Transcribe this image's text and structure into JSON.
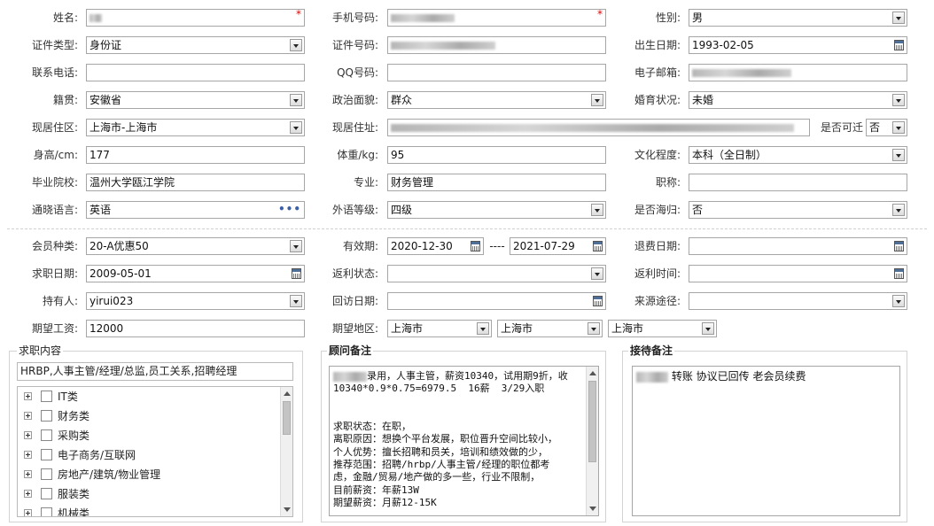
{
  "personal": {
    "name": {
      "label": "姓名:",
      "value_masked": true,
      "required_mark": "*"
    },
    "mobile": {
      "label": "手机号码:",
      "value_masked": true,
      "required_mark": "*"
    },
    "gender": {
      "label": "性别:",
      "value": "男"
    },
    "id_type": {
      "label": "证件类型:",
      "value": "身份证"
    },
    "id_number": {
      "label": "证件号码:",
      "value_masked": true
    },
    "birth_date": {
      "label": "出生日期:",
      "value": "1993-02-05"
    },
    "phone": {
      "label": "联系电话:",
      "value": ""
    },
    "qq": {
      "label": "QQ号码:",
      "value": ""
    },
    "email": {
      "label": "电子邮箱:",
      "value_masked": true
    },
    "native_place": {
      "label": "籍贯:",
      "value": "安徽省"
    },
    "political_status": {
      "label": "政治面貌:",
      "value": "群众"
    },
    "marital_status": {
      "label": "婚育状况:",
      "value": "未婚"
    },
    "residence_area": {
      "label": "现居住区:",
      "value": "上海市-上海市"
    },
    "residence_address": {
      "label": "现居住址:",
      "value_masked": true
    },
    "can_relocate": {
      "label": "是否可迁",
      "value": "否"
    },
    "height": {
      "label": "身高/cm:",
      "value": "177"
    },
    "weight": {
      "label": "体重/kg:",
      "value": "95"
    },
    "education": {
      "label": "文化程度:",
      "value": "本科（全日制）"
    },
    "school": {
      "label": "毕业院校:",
      "value": "温州大学瓯江学院"
    },
    "major": {
      "label": "专业:",
      "value": "财务管理"
    },
    "title": {
      "label": "职称:",
      "value": ""
    },
    "language": {
      "label": "通晓语言:",
      "value": "英语",
      "more": "•••"
    },
    "foreign_level": {
      "label": "外语等级:",
      "value": "四级"
    },
    "overseas": {
      "label": "是否海归:",
      "value": "否"
    }
  },
  "membership": {
    "member_type": {
      "label": "会员种类:",
      "value": "20-A优惠50"
    },
    "valid_period": {
      "label": "有效期:",
      "start": "2020-12-30",
      "sep": "----",
      "end": "2021-07-29"
    },
    "refund_date": {
      "label": "退费日期:",
      "value": ""
    },
    "job_date": {
      "label": "求职日期:",
      "value": "2009-05-01"
    },
    "rebate_status": {
      "label": "返利状态:",
      "value": ""
    },
    "rebate_time": {
      "label": "返利时间:",
      "value": ""
    },
    "holder": {
      "label": "持有人:",
      "value": "yirui023"
    },
    "visit_date": {
      "label": "回访日期:",
      "value": ""
    },
    "source": {
      "label": "来源途径:",
      "value": ""
    },
    "expected_salary": {
      "label": "期望工资:",
      "value": "12000"
    },
    "expected_area": {
      "label": "期望地区:",
      "values": [
        "上海市",
        "上海市",
        "上海市"
      ]
    }
  },
  "job_content": {
    "title": "求职内容",
    "summary": "HRBP,人事主管/经理/总监,员工关系,招聘经理",
    "categories": [
      "IT类",
      "财务类",
      "采购类",
      "电子商务/互联网",
      "房地产/建筑/物业管理",
      "服装类",
      "机械类"
    ]
  },
  "consultant_notes": {
    "title": "顾问备注",
    "lines": [
      "录用，人事主管，薪资10340，试用期9折，收",
      "10340*0.9*0.75=6979.5  16薪  3/29入职",
      "",
      "",
      "求职状态：在职，",
      "离职原因：想换个平台发展，职位晋升空间比较小，",
      "个人优势：擅长招聘和员关，培训和绩效做的少，",
      "推荐范围：招聘/hrbp/人事主管/经理的职位都考",
      "虑，金融/贸易/地产做的多一些，行业不限制，",
      "目前薪资：年薪13W",
      "期望薪资：月薪12-15K"
    ]
  },
  "reception_notes": {
    "title": "接待备注",
    "text": "转账 协议已回传 老会员续费"
  }
}
